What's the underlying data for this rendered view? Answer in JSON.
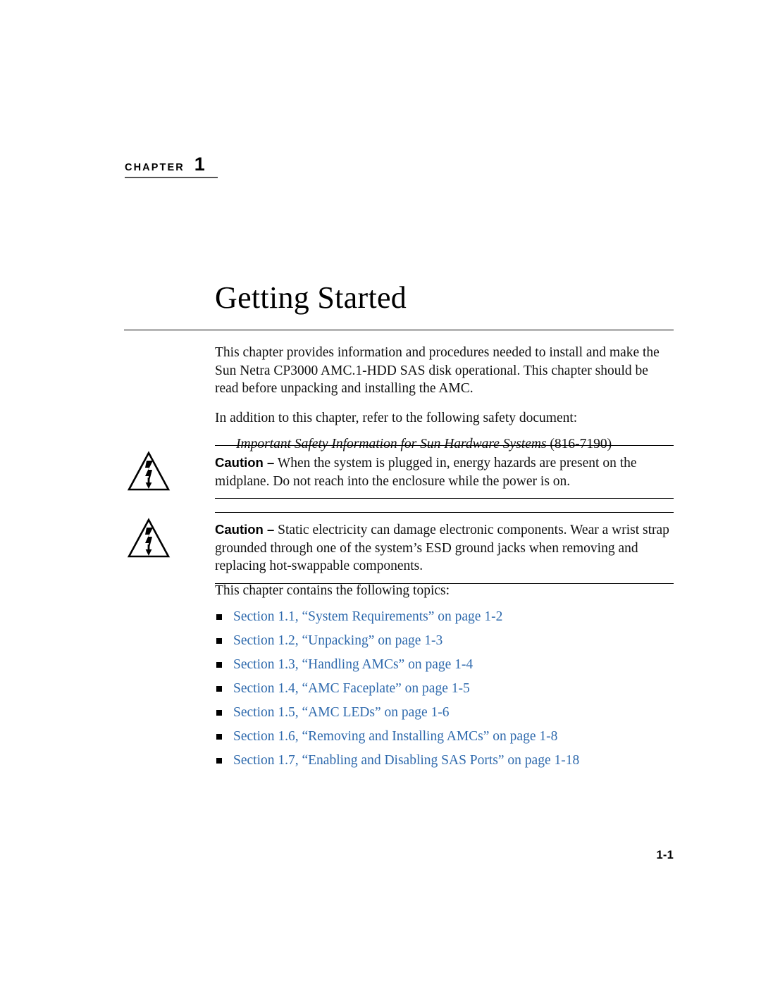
{
  "chapter": {
    "eyebrow_word": "CHAPTER",
    "eyebrow_number": "1",
    "title": "Getting Started"
  },
  "intro": {
    "paragraph_1": "This chapter provides information and procedures needed to install and make the Sun Netra CP3000 AMC.1-HDD SAS disk operational. This chapter should be read before unpacking and installing the AMC.",
    "paragraph_2": "In addition to this chapter, refer to the following safety document:",
    "safety_document_title": "Important Safety Information for Sun Hardware Systems",
    "safety_document_number": "(816-7190)"
  },
  "cautions": [
    {
      "icon": "electric-shock-hazard-icon",
      "label": "Caution –",
      "text": " When the system is plugged in, energy hazards are present on the midplane. Do not reach into the enclosure while the power is on."
    },
    {
      "icon": "electric-shock-hazard-icon",
      "label": "Caution –",
      "text": " Static electricity can damage electronic components. Wear a wrist strap grounded through one of the system’s ESD ground jacks when removing and replacing hot-swappable components."
    }
  ],
  "topics": {
    "lead_in": "This chapter contains the following topics:",
    "items": [
      {
        "label": "Section 1.1, “System Requirements” on page 1-2"
      },
      {
        "label": "Section 1.2, “Unpacking” on page 1-3"
      },
      {
        "label": "Section 1.3, “Handling AMCs” on page 1-4"
      },
      {
        "label": "Section 1.4, “AMC Faceplate” on page 1-5"
      },
      {
        "label": "Section 1.5, “AMC LEDs” on page 1-6"
      },
      {
        "label": "Section 1.6, “Removing and Installing AMCs” on page 1-8"
      },
      {
        "label": "Section 1.7, “Enabling and Disabling SAS Ports” on page 1-18"
      }
    ]
  },
  "footer": {
    "page_number": "1-1"
  },
  "colors": {
    "link": "#2f6aad",
    "rule": "#000000",
    "text": "#111111"
  }
}
